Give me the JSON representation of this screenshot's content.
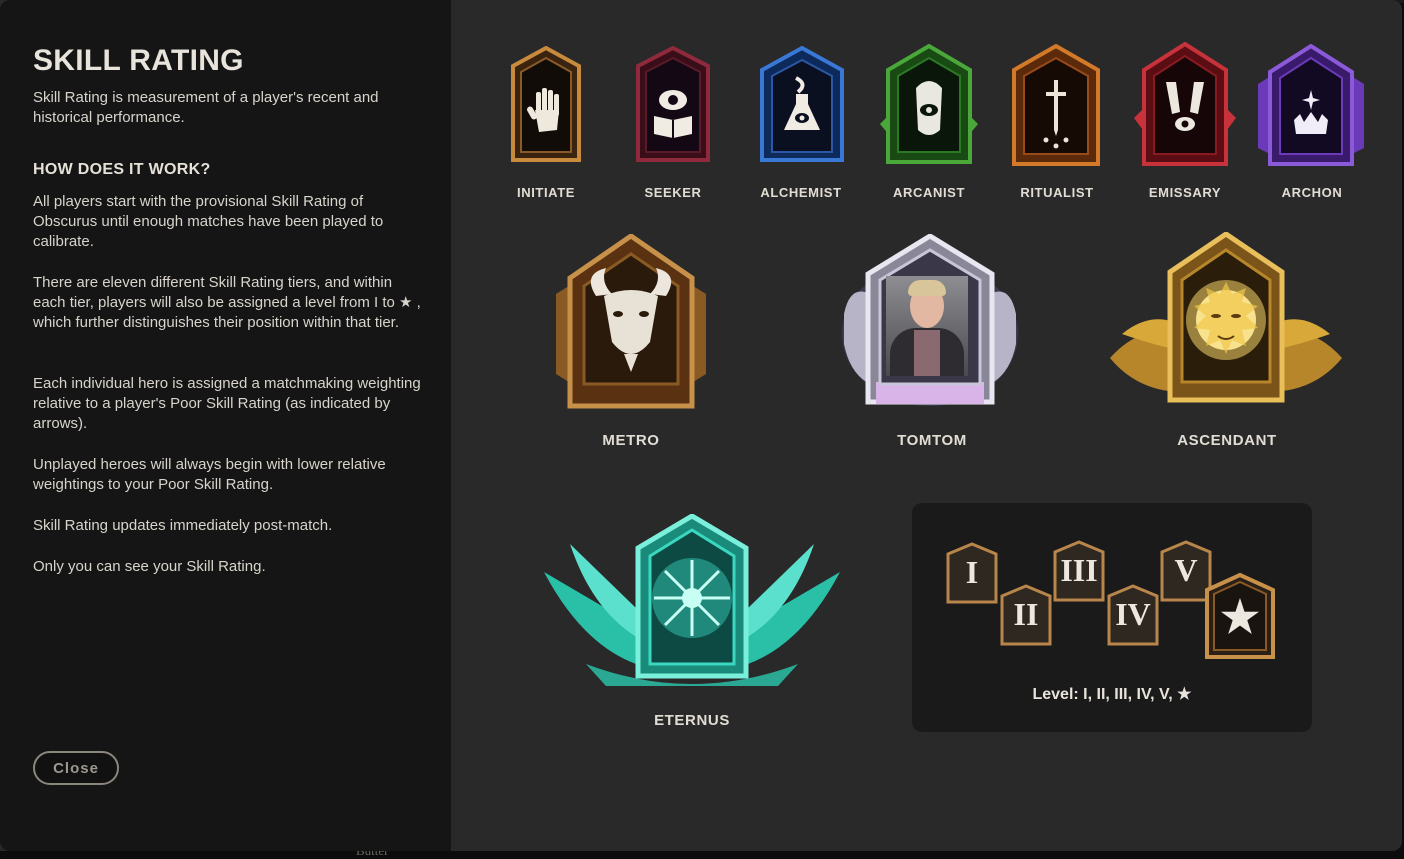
{
  "title": "SKILL RATING",
  "intro": "Skill Rating is measurement of a player's recent and historical performance.",
  "how_heading": "HOW DOES IT WORK?",
  "paragraphs": [
    "All players start with the provisional Skill Rating of Obscurus until enough matches have been played to calibrate.",
    "There are eleven different Skill Rating tiers, and within each tier, players will also be assigned a level from I to ★ , which further distinguishes their position within that tier.",
    "Each individual hero is assigned a matchmaking weighting relative to a player's Poor Skill Rating (as indicated by arrows).",
    "Unplayed heroes will always begin with lower relative weightings to your Poor Skill Rating.",
    "Skill Rating updates immediately post-match.",
    "Only you can see your Skill Rating."
  ],
  "close_label": "Close",
  "tiers_small": [
    {
      "name": "INITIATE",
      "color": "#c88a3c",
      "icon": "hand-icon"
    },
    {
      "name": "SEEKER",
      "color": "#8e2a3c",
      "icon": "eye-book-icon"
    },
    {
      "name": "ALCHEMIST",
      "color": "#3a78d6",
      "icon": "flask-icon"
    },
    {
      "name": "ARCANIST",
      "color": "#4aa83a",
      "icon": "eye-hand-icon"
    },
    {
      "name": "RITUALIST",
      "color": "#d27a2a",
      "icon": "dagger-icon"
    },
    {
      "name": "EMISSARY",
      "color": "#c8323a",
      "icon": "hands-eye-icon"
    },
    {
      "name": "ARCHON",
      "color": "#8a5ad8",
      "icon": "crown-icon"
    }
  ],
  "tiers_large": [
    {
      "name": "METRO",
      "color": "#b87a3a",
      "icon": "goat-icon"
    },
    {
      "name": "TOMTOM",
      "color": "#c8c6d8",
      "icon": "avatar-photo"
    },
    {
      "name": "ASCENDANT",
      "color": "#d8a838",
      "icon": "sun-face-icon"
    },
    {
      "name": "ETERNUS",
      "color": "#3ad8c0",
      "icon": "snowflake-icon"
    }
  ],
  "levels": [
    "I",
    "II",
    "III",
    "IV",
    "V",
    "★"
  ],
  "level_caption": "Level: I, II, III, IV, V, ★",
  "bottom_peek": "Butter"
}
